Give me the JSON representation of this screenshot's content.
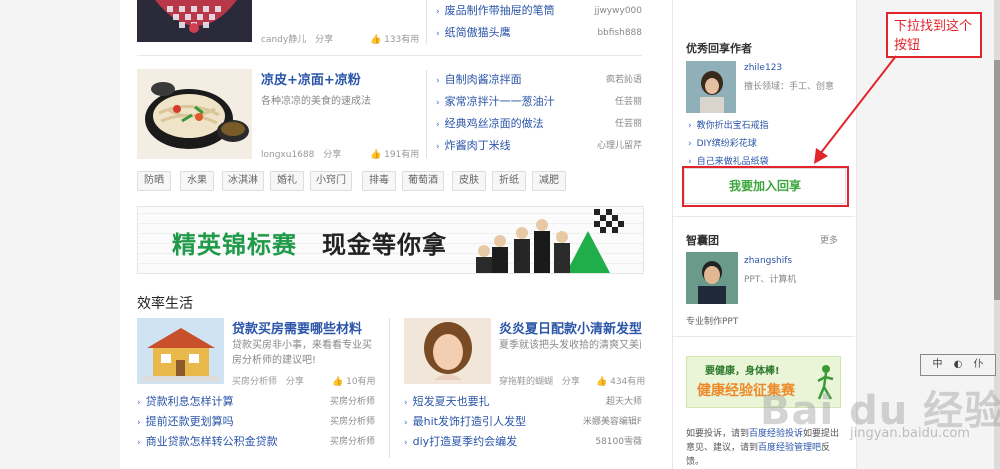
{
  "top_section": {
    "author": "candy静儿",
    "share": "分享",
    "useful": "133有用",
    "list": [
      {
        "title": "废品制作带抽屉的笔筒",
        "author": "jjwywy000"
      },
      {
        "title": "纸简傲猫头鹰",
        "author": "bbfish888"
      }
    ]
  },
  "section2": {
    "title": "凉皮+凉面+凉粉",
    "desc": "各种凉凉的美食的速成法",
    "author": "longxu1688",
    "share": "分享",
    "useful": "191有用",
    "list": [
      {
        "title": "自制肉酱凉拌面",
        "author": "疯若訫语"
      },
      {
        "title": "家常凉拌汁一一葱油汁",
        "author": "任芸丽"
      },
      {
        "title": "经典鸡丝凉面的做法",
        "author": "任芸丽"
      },
      {
        "title": "炸酱肉丁米线",
        "author": "心理儿留芹"
      }
    ]
  },
  "tags": [
    "防晒",
    "水果",
    "冰淇淋",
    "婚礼",
    "小窍门",
    "排毒",
    "葡萄酒",
    "皮肤",
    "折纸",
    "减肥"
  ],
  "banner": {
    "text_green": "精英锦标赛",
    "text_dark": "现金等你拿"
  },
  "efficiency": {
    "heading": "效率生活",
    "left": {
      "title": "贷款买房需要哪些材料",
      "desc": "贷款买房非小事，来看看专业买房分析师的建议吧!",
      "author": "买房分析师",
      "share": "分享",
      "useful": "10有用",
      "list": [
        {
          "title": "贷款利息怎样计算",
          "author": "买房分析师"
        },
        {
          "title": "提前还款更划算吗",
          "author": "买房分析师"
        },
        {
          "title": "商业贷款怎样转公积金贷款",
          "author": "买房分析师"
        }
      ]
    },
    "right": {
      "title": "炎炎夏日配款小清新发型",
      "desc": "夏季就该把头发收拾的清爽又美丽",
      "author": "穿拖鞋的蝴蝴",
      "share": "分享",
      "useful": "434有用",
      "list": [
        {
          "title": "短发夏天也要扎",
          "author": "超天大师"
        },
        {
          "title": "最hit发饰打造引人发型",
          "author": "米娜美容编辑F"
        },
        {
          "title": "diy打造夏季约会编发",
          "author": "58100雪薇"
        }
      ]
    }
  },
  "sidebar": {
    "sharers_heading": "优秀回享作者",
    "user": {
      "name": "zhile123",
      "skills": "擅长领域：手工、创意"
    },
    "items": [
      "教你折出宝石戒指",
      "DIY缤纷彩花球",
      "自己来做礼品纸袋"
    ],
    "join_button": "我要加入回享",
    "zhinang": {
      "heading": "智囊团",
      "more": "更多",
      "name": "zhangshifs",
      "skills": "PPT、计算机",
      "note": "专业制作PPT"
    },
    "ad": {
      "line1": "要健康，身体棒!",
      "line2": "健康经验征集赛"
    },
    "footer": {
      "p1": "如要投诉，请到",
      "link1": "百度经验投诉",
      "p2": "如",
      "p3": "要提出意见、建议，请到",
      "link2": "百度经验管理吧",
      "p4": "反馈。"
    }
  },
  "annotation": {
    "text": "下拉找到这个按钮"
  },
  "widget": {
    "labels": [
      "中",
      "◐",
      "仆"
    ]
  },
  "watermark": {
    "brand": "Bai du 经验",
    "url": "jingyan.baidu.com"
  }
}
